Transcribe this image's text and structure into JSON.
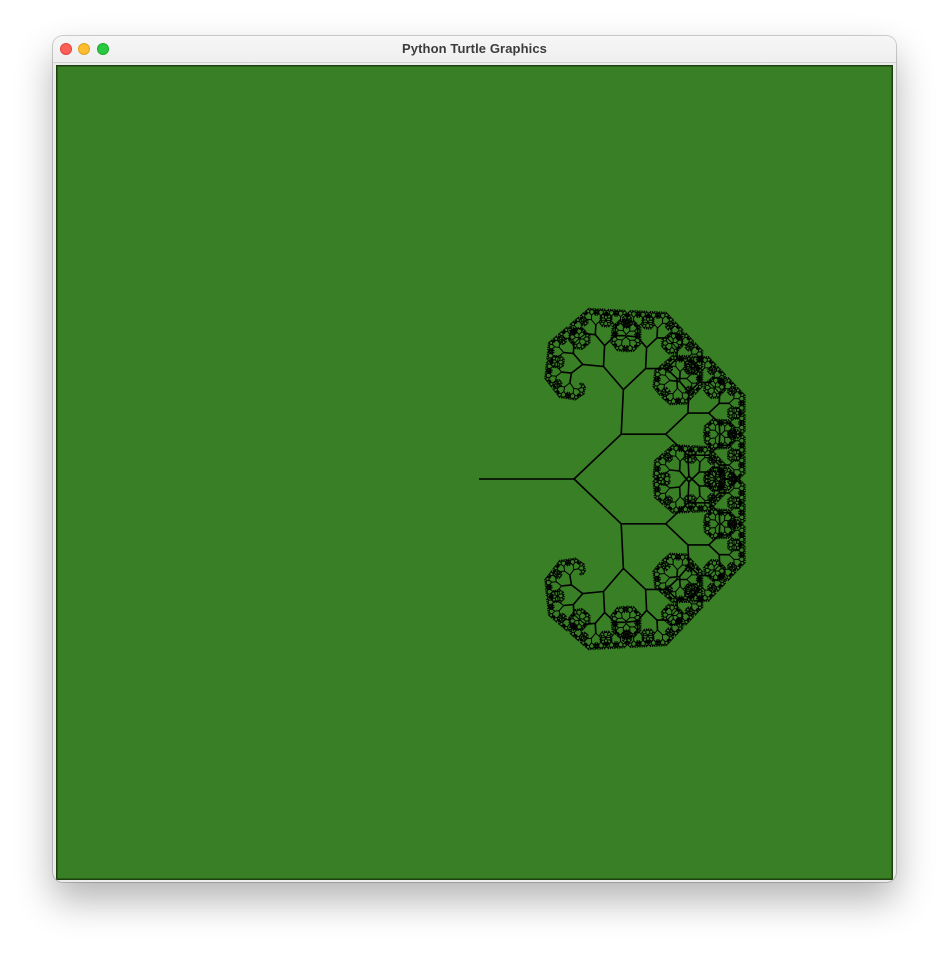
{
  "window": {
    "title": "Python Turtle Graphics",
    "controls": {
      "close": "close-button",
      "minimize": "minimize-button",
      "zoom": "zoom-button"
    }
  },
  "canvas": {
    "background_color": "#387f25",
    "pen_color": "#000000",
    "drawing": "recursive fractal tree (turtle graphics)"
  },
  "colors": {
    "close": "#fe5f57",
    "minimize": "#febc2e",
    "zoom": "#28c840"
  }
}
